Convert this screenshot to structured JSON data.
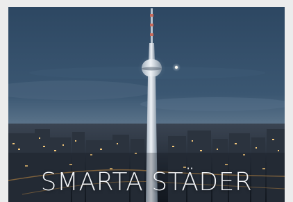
{
  "banner": {
    "title": "SMARTA STÄDER",
    "image_subject": "tv-tower-city-skyline-at-dusk"
  },
  "colors": {
    "page_background": "#ececec",
    "sky_top": "#33506c",
    "sky_horizon": "#8a9cad",
    "city_lights": "#f3c77a",
    "tower": "#cfd8e1",
    "caption_text": "#f2f4f7"
  }
}
